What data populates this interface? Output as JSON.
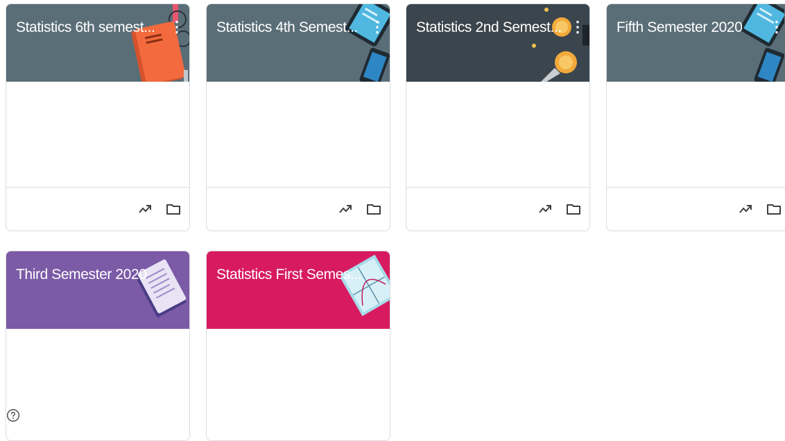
{
  "colors": {
    "banner_gray": "#5a6e78",
    "banner_dark": "#3b454d",
    "banner_purple": "#7b5aa6",
    "banner_pink": "#d81b60"
  },
  "classes": [
    {
      "title": "Statistics 6th semest...",
      "banner": "#5a6e78",
      "art": "book-and-glasses-icon",
      "has_menu": true
    },
    {
      "title": "Statistics 4th Semest...",
      "banner": "#5a6e78",
      "art": "tablet-and-phone-icon",
      "has_menu": true
    },
    {
      "title": "Statistics 2nd Semest...",
      "banner": "#3b454d",
      "art": "coins-icon",
      "has_menu": true
    },
    {
      "title": "Fifth Semester 2020",
      "banner": "#5a6e78",
      "art": "tablet-and-phone-icon",
      "has_menu": true
    },
    {
      "title": "Third Semester 2020",
      "banner": "#7b5aa6",
      "art": "notebook-icon",
      "has_menu": false
    },
    {
      "title": "Statistics First Semes...",
      "banner": "#d81b60",
      "art": "graph-paper-icon",
      "has_menu": false
    }
  ],
  "footer_icons": [
    "trending-up-icon",
    "folder-icon"
  ],
  "help_icon": "help-circle-icon"
}
